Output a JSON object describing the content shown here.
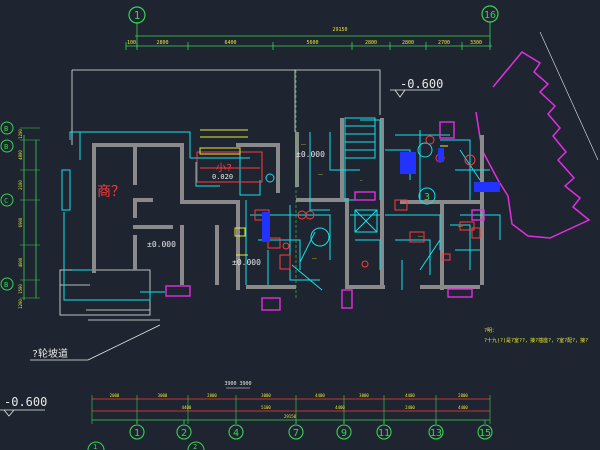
{
  "colors": {
    "background": "#1e2530",
    "dimension": "#39d353",
    "wall": "#9a9a9a",
    "cyan": "#14e0e8",
    "magenta": "#e22ee2",
    "yellow": "#e8e832",
    "red": "#ff3a3a",
    "white": "#e8e8e8",
    "blue": "#2233ff"
  },
  "grid_bubbles": {
    "top_left": "1",
    "top_right": "16",
    "bottom": [
      "1",
      "2",
      "4",
      "7",
      "9",
      "11",
      "13",
      "15"
    ],
    "left": [
      "B",
      "B",
      "C",
      "B"
    ],
    "bottom_partial_left": "1",
    "bottom_partial_2": "2"
  },
  "top_dimensions": {
    "total": "29150",
    "segments": [
      "100",
      "2800",
      "6400",
      "5600",
      "2800",
      "2800",
      "2700",
      "3300"
    ]
  },
  "bottom_dimensions": {
    "row1": [
      "2000",
      "3000",
      "2000",
      "3000",
      "4400",
      "3000",
      "4400",
      "2800"
    ],
    "row2": [
      "4400",
      "5100",
      "4400",
      "2400",
      "4400"
    ],
    "total": "29150",
    "small": "3900 3900"
  },
  "left_dimensions": [
    "1200",
    "4800",
    "2100",
    "6900",
    "4800",
    "1500",
    "1200"
  ],
  "elevations": {
    "main": "-0.600",
    "lower_left": "-0.600",
    "room_a": "±0.000",
    "room_b": "±0.000",
    "room_c": "±0.000",
    "small": "0.020"
  },
  "room_labels": {
    "big_room": "商？",
    "red_room": "小?",
    "entry_tag": "3"
  },
  "annotations": {
    "ramp": "?轮坡道",
    "note_title": "?明：",
    "note_line": "?十九(?)是?室??，接?插座?，?室?配?，接?"
  }
}
